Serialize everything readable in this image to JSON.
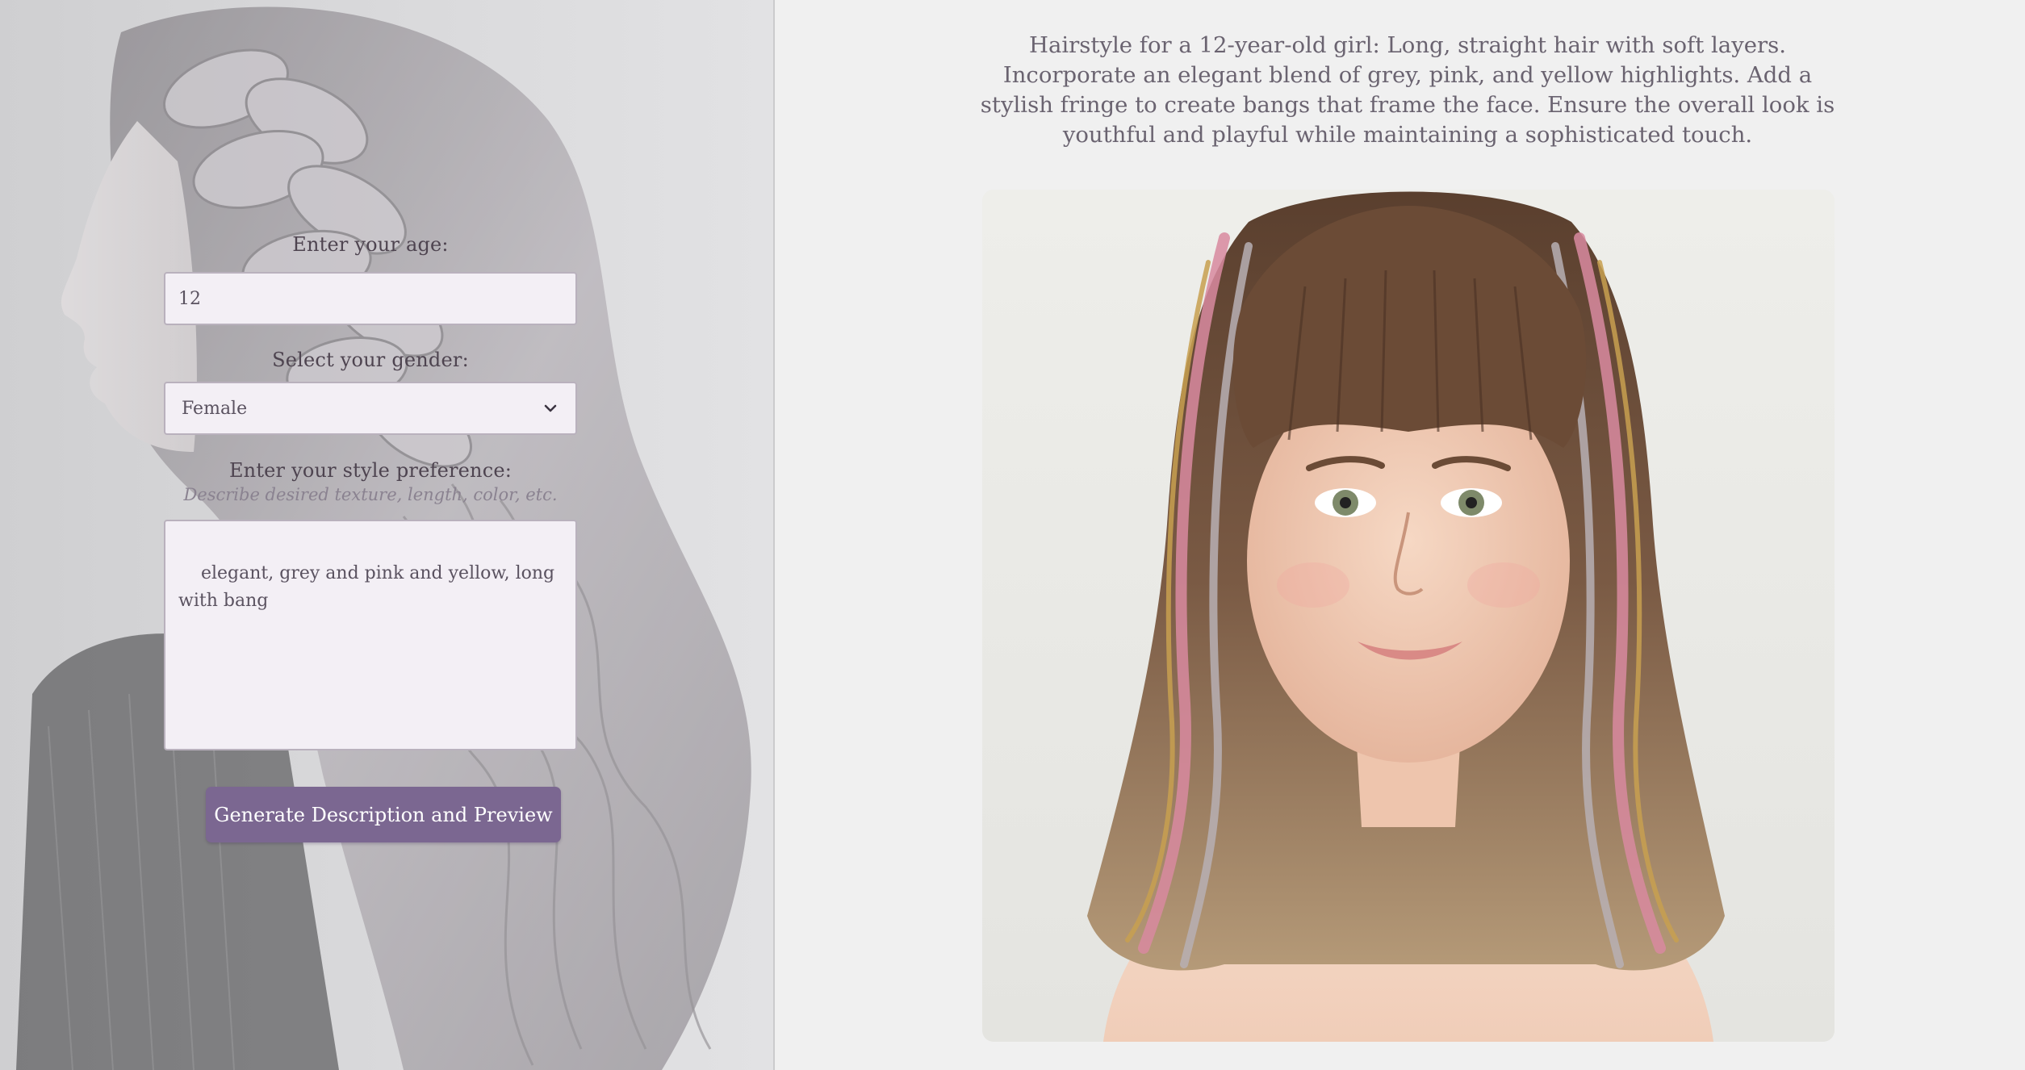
{
  "form": {
    "age_label": "Enter your age:",
    "age_value": "12",
    "gender_label": "Select your gender:",
    "gender_selected": "Female",
    "style_label": "Enter your style preference:",
    "style_hint": "Describe desired texture, length, color, etc.",
    "style_value": "elegant, grey and pink and yellow, long with bang",
    "generate_label": "Generate Description and Preview"
  },
  "result": {
    "description": "Hairstyle for a 12-year-old girl: Long, straight hair with soft layers. Incorporate an elegant blend of grey, pink, and yellow highlights. Add a stylish fringe to create bangs that frame the face. Ensure the overall look is youthful and playful while maintaining a sophisticated touch."
  },
  "icons": {
    "select_chevron": "chevron-down-icon"
  },
  "colors": {
    "accent": "#7b6791",
    "field_background": "#f3eff5",
    "page_background": "#f0f0f0"
  }
}
